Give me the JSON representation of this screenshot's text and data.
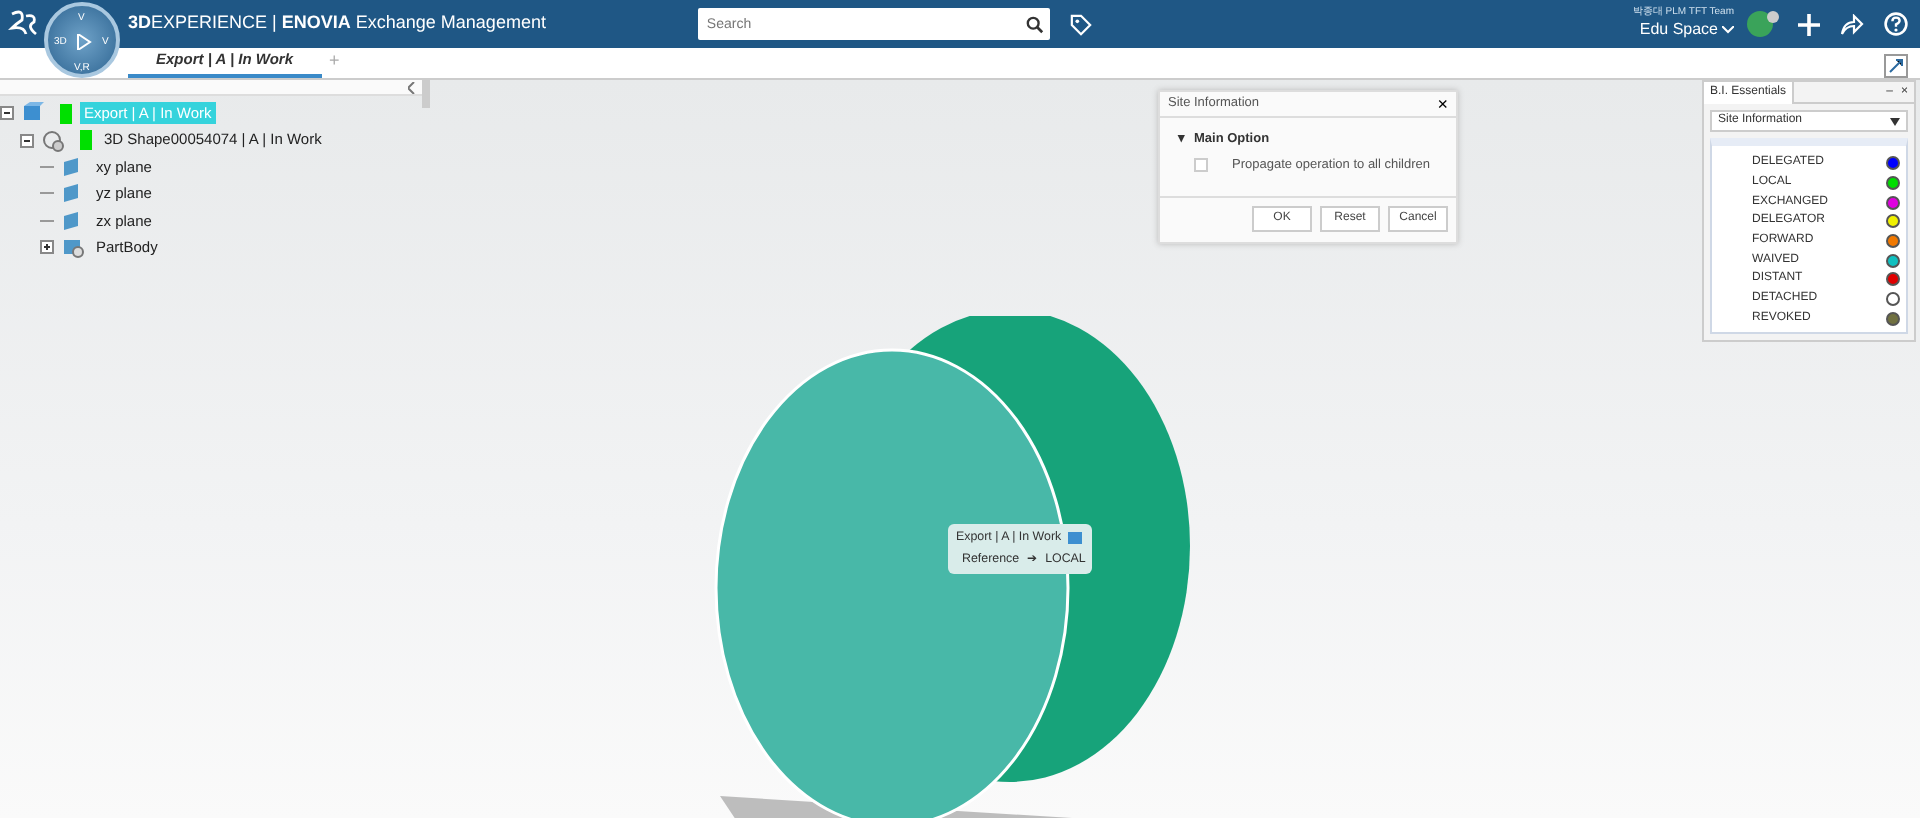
{
  "header": {
    "title": "**3D**EXPERIENCE | **ENOVIA** Exchange Management",
    "compass": {
      "top": "V",
      "left": "3D",
      "right": "V",
      "bottom": "V,R"
    },
    "search": {
      "placeholder": "Search"
    },
    "user": "박종대 PLM TFT Team",
    "space": "Edu Space"
  },
  "tabs": [
    {
      "label": "Export | A | In Work",
      "selected": true
    }
  ],
  "add_tab": "+",
  "tree": [
    {
      "label": "Export | A | In Work",
      "kind": "product",
      "color": "#00e000",
      "selected": true,
      "expanded": true,
      "children": [
        {
          "label": "3D Shape00054074 | A | In Work",
          "kind": "shape",
          "color": "#00e000",
          "selected": false,
          "expanded": true,
          "children": [
            {
              "label": "xy plane",
              "kind": "plane",
              "selected": false
            },
            {
              "label": "yz plane",
              "kind": "plane",
              "selected": false
            },
            {
              "label": "zx plane",
              "kind": "plane",
              "selected": false
            },
            {
              "label": "PartBody",
              "kind": "body",
              "selected": false,
              "expanded": false
            }
          ]
        }
      ]
    }
  ],
  "dialog": {
    "title": "Site Information",
    "close": "×",
    "section_toggle": "▾",
    "section": "Main Option",
    "option": {
      "label": "Propagate operation to all children",
      "checked": false
    },
    "buttons": [
      "OK",
      "Reset",
      "Cancel"
    ]
  },
  "panel": {
    "title": "B.I. Essentials",
    "minimize": "–",
    "close": "×",
    "select": "Site Information",
    "legend": [
      {
        "label": "DELEGATED",
        "color": "#0000ff"
      },
      {
        "label": "LOCAL",
        "color": "#00dd00"
      },
      {
        "label": "EXCHANGED",
        "color": "#e000e0"
      },
      {
        "label": "DELEGATOR",
        "color": "#f0f000"
      },
      {
        "label": "FORWARD",
        "color": "#f07800"
      },
      {
        "label": "WAIVED",
        "color": "#10c0c0"
      },
      {
        "label": "DISTANT",
        "color": "#e00000"
      },
      {
        "label": "DETACHED",
        "color": "#ffffff"
      },
      {
        "label": "REVOKED",
        "color": "#707040"
      }
    ]
  },
  "tooltip": {
    "title": "Export | A | In Work",
    "reference": "Reference",
    "arrow": "➔",
    "value": "LOCAL"
  }
}
